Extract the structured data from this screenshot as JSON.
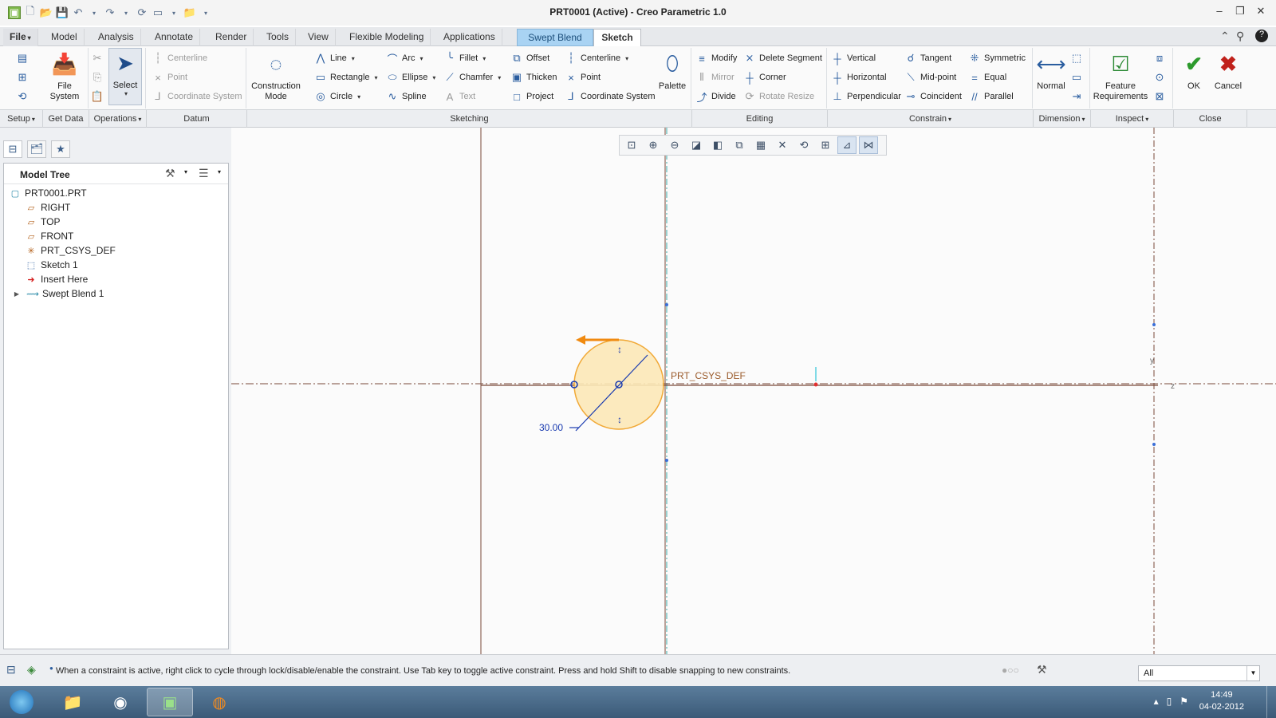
{
  "window": {
    "title": "PRT0001 (Active) - Creo Parametric 1.0",
    "controls": [
      "minimize-icon",
      "restore-icon",
      "close-icon"
    ]
  },
  "tabs": [
    "File",
    "Model",
    "Analysis",
    "Annotate",
    "Render",
    "Tools",
    "View",
    "Flexible Modeling",
    "Applications",
    "Swept Blend",
    "Sketch"
  ],
  "active_tab": "Sketch",
  "ribbon": {
    "setup": {
      "file_system": "File\nSystem"
    },
    "operations": {
      "select": "Select"
    },
    "datum": {
      "centerline": "Centerline",
      "point": "Point",
      "coordinate_system": "Coordinate System"
    },
    "sketching": {
      "construction_mode": "Construction\nMode",
      "line": "Line",
      "rectangle": "Rectangle",
      "circle": "Circle",
      "arc": "Arc",
      "ellipse": "Ellipse",
      "spline": "Spline",
      "fillet": "Fillet",
      "chamfer": "Chamfer",
      "text": "Text",
      "offset": "Offset",
      "thicken": "Thicken",
      "project": "Project",
      "centerline": "Centerline",
      "point": "Point",
      "coordinate_system": "Coordinate System",
      "palette": "Palette"
    },
    "editing": {
      "modify": "Modify",
      "delete_segment": "Delete Segment",
      "mirror": "Mirror",
      "corner": "Corner",
      "divide": "Divide",
      "rotate_resize": "Rotate Resize"
    },
    "constrain": {
      "vertical": "Vertical",
      "tangent": "Tangent",
      "symmetric": "Symmetric",
      "horizontal": "Horizontal",
      "mid_point": "Mid-point",
      "equal": "Equal",
      "perpendicular": "Perpendicular",
      "coincident": "Coincident",
      "parallel": "Parallel"
    },
    "dimension": {
      "normal": "Normal"
    },
    "inspect": {
      "feature_requirements": "Feature\nRequirements"
    },
    "close": {
      "ok": "OK",
      "cancel": "Cancel"
    }
  },
  "groups": [
    "Setup",
    "Get Data",
    "Operations",
    "Datum",
    "Sketching",
    "Editing",
    "Constrain",
    "Dimension",
    "Inspect",
    "Close"
  ],
  "model_tree": {
    "header": "Model Tree",
    "items": [
      "PRT0001.PRT",
      "RIGHT",
      "TOP",
      "FRONT",
      "PRT_CSYS_DEF",
      "Sketch 1",
      "Insert Here",
      "Swept Blend 1"
    ]
  },
  "canvas": {
    "csys_label": "PRT_CSYS_DEF",
    "dimension_value": "30.00",
    "axis_y": "y",
    "axis_z": "z"
  },
  "status": {
    "message": "When a constraint is active, right click to cycle through lock/disable/enable the constraint. Use Tab key to toggle active constraint. Press and hold Shift to disable snapping to new constraints.",
    "filter": "All"
  },
  "taskbar": {
    "time": "14:49",
    "date": "04-02-2012"
  }
}
